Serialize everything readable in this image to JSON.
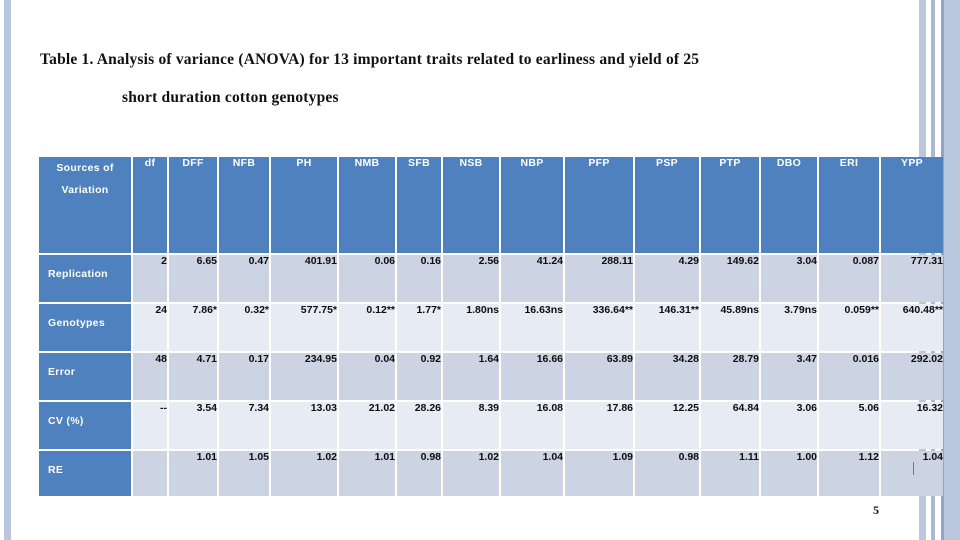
{
  "slide": {
    "page_number": "5",
    "title_line_1": "Table 1.  Analysis of variance (ANOVA) for 13 important traits related to earliness and yield of 25",
    "title_line_2": "short duration cotton genotypes",
    "colors": {
      "header_blue": "#4e81bd",
      "row_shade_dark": "#ccd4e3",
      "row_shade_light": "#e7ebf4",
      "frame_band": "#b9c7df",
      "text_dark": "#0d0d0d",
      "header_text": "#ffffff"
    }
  },
  "table": {
    "headers": [
      "Sources of Variation",
      "df",
      "DFF",
      "NFB",
      "PH",
      "NMB",
      "SFB",
      "NSB",
      "NBP",
      "PFP",
      "PSP",
      "PTP",
      "DBO",
      "ERI",
      "YPP"
    ],
    "rows": [
      {
        "label": "Replication",
        "cells": [
          "2",
          "6.65",
          "0.47",
          "401.91",
          "0.06",
          "0.16",
          "2.56",
          "41.24",
          "288.11",
          "4.29",
          "149.62",
          "3.04",
          "0.087",
          "777.31"
        ]
      },
      {
        "label": "Genotypes",
        "cells": [
          "24",
          "7.86*",
          "0.32*",
          "577.75*",
          "0.12**",
          "1.77*",
          "1.80ns",
          "16.63ns",
          "336.64**",
          "146.31**",
          "45.89ns",
          "3.79ns",
          "0.059**",
          "640.48**"
        ]
      },
      {
        "label": "Error",
        "cells": [
          "48",
          "4.71",
          "0.17",
          "234.95",
          "0.04",
          "0.92",
          "1.64",
          "16.66",
          "63.89",
          "34.28",
          "28.79",
          "3.47",
          "0.016",
          "292.02"
        ]
      },
      {
        "label": "CV (%)",
        "cells": [
          "--",
          "3.54",
          "7.34",
          "13.03",
          "21.02",
          "28.26",
          "8.39",
          "16.08",
          "17.86",
          "12.25",
          "64.84",
          "3.06",
          "5.06",
          "16.32"
        ]
      },
      {
        "label": "RE",
        "cells": [
          "",
          "1.01",
          "1.05",
          "1.02",
          "1.01",
          "0.98",
          "1.02",
          "1.04",
          "1.09",
          "0.98",
          "1.11",
          "1.00",
          "1.12",
          "1.04"
        ]
      }
    ]
  }
}
